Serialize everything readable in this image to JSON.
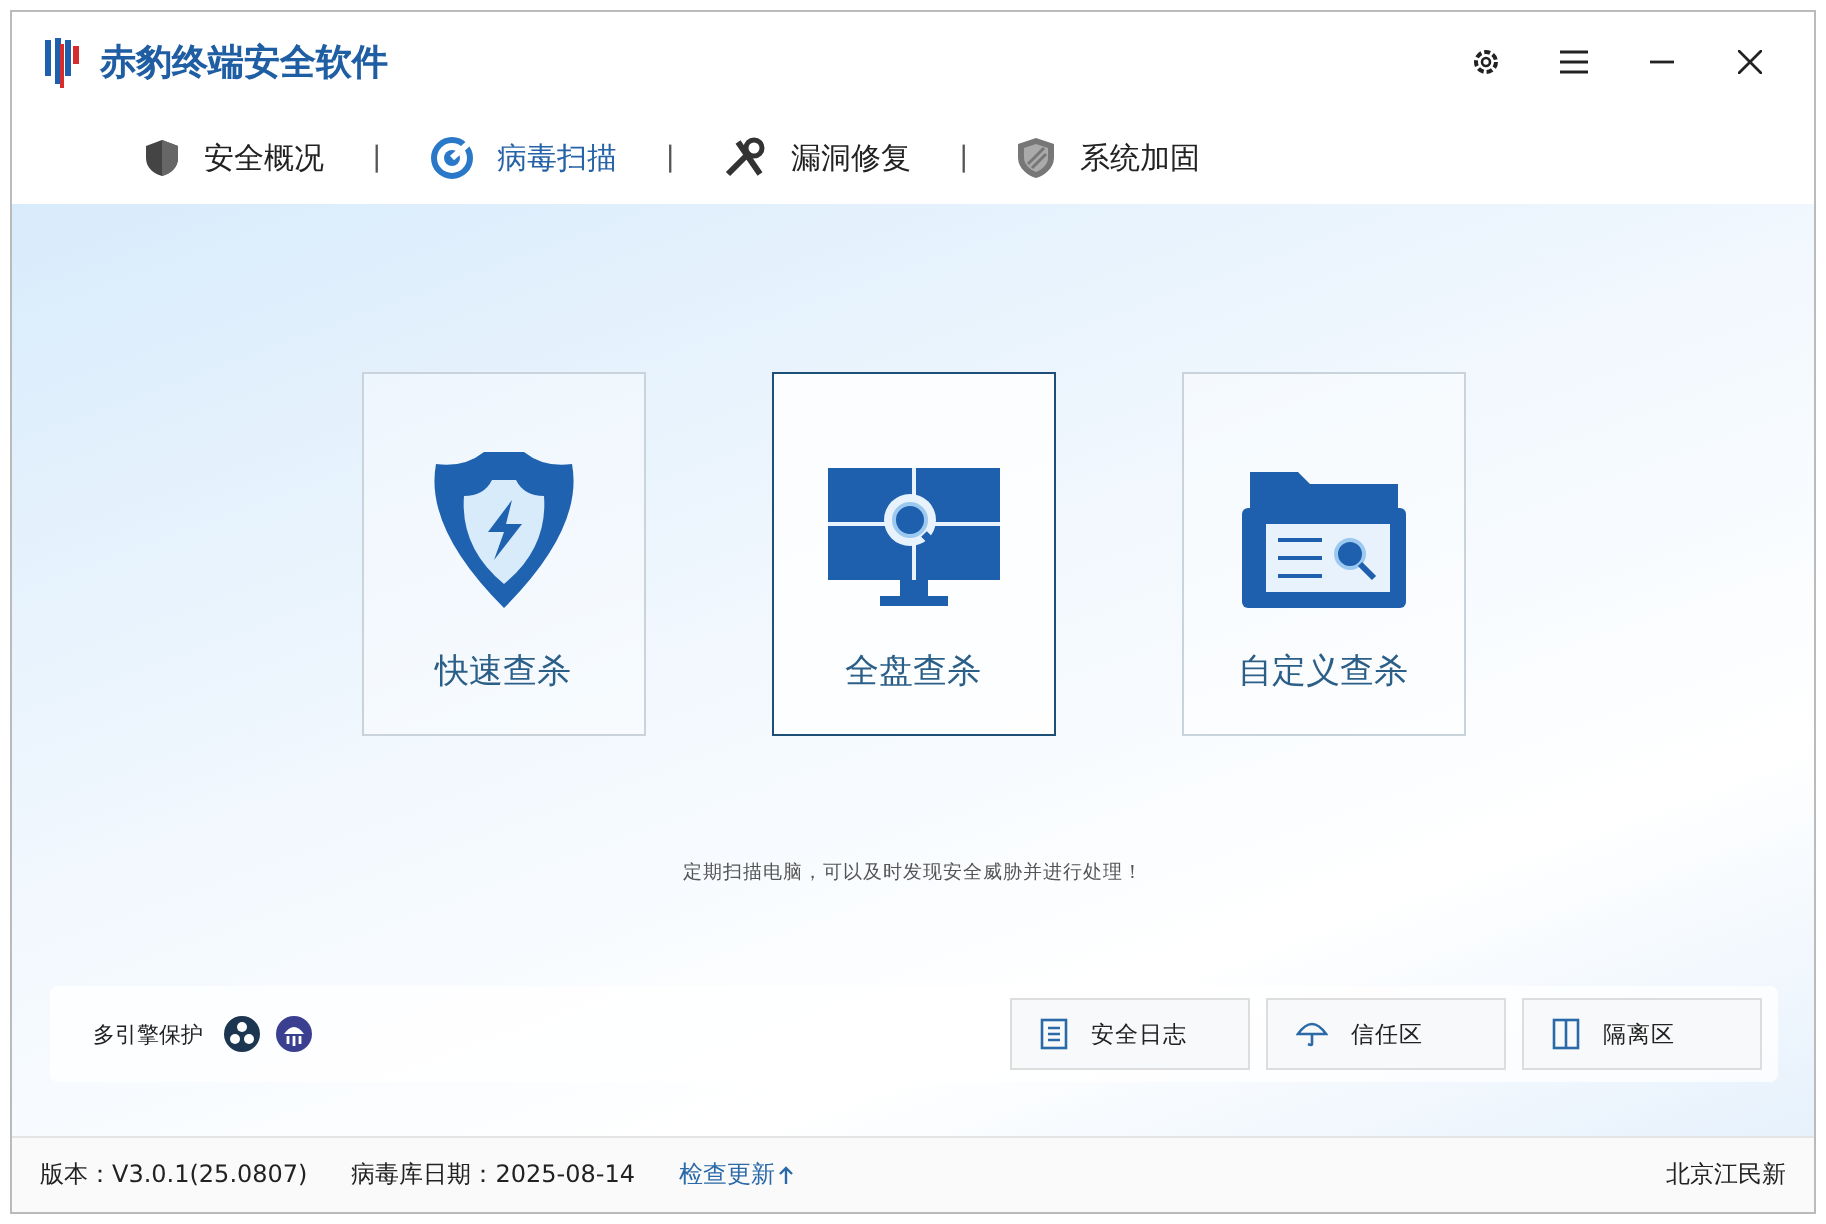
{
  "window": {
    "title": "赤豹终端安全软件"
  },
  "tabs": [
    {
      "label": "安全概况",
      "selected": false,
      "kind": "overview"
    },
    {
      "label": "病毒扫描",
      "selected": true,
      "kind": "scan"
    },
    {
      "label": "漏洞修复",
      "selected": false,
      "kind": "repair"
    },
    {
      "label": "系统加固",
      "selected": false,
      "kind": "harden"
    }
  ],
  "tab_separators": [
    "|",
    "|",
    "|"
  ],
  "scan_options": [
    {
      "label": "快速查杀",
      "selected": false,
      "kind": "quick"
    },
    {
      "label": "全盘查杀",
      "selected": true,
      "kind": "full"
    },
    {
      "label": "自定义查杀",
      "selected": false,
      "kind": "custom"
    }
  ],
  "hint": "定期扫描电脑，可以及时发现安全威胁并进行处理！",
  "engine_panel": {
    "label": "多引擎保护",
    "buttons": [
      {
        "label": "安全日志",
        "kind": "log"
      },
      {
        "label": "信任区",
        "kind": "trust"
      },
      {
        "label": "隔离区",
        "kind": "quarantine"
      }
    ]
  },
  "status_bar": {
    "version": "版本：V3.0.1(25.0807)",
    "db_date": "病毒库日期：2025-08-14",
    "update_link": "检查更新",
    "company": "北京江民新"
  }
}
